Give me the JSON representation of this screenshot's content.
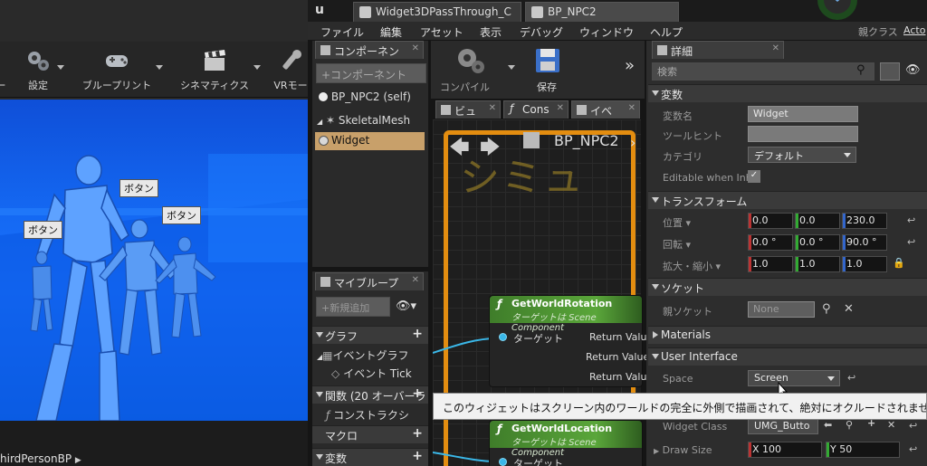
{
  "left_toolbar": {
    "items": [
      {
        "label": "ー",
        "icon": "partial-icon"
      },
      {
        "label": "設定",
        "icon": "gears-icon"
      },
      {
        "label": "ブループリント",
        "icon": "gamepad-icon"
      },
      {
        "label": "シネマティクス",
        "icon": "clapperboard-icon"
      },
      {
        "label": "VRモー",
        "icon": "wrench-icon"
      }
    ]
  },
  "viewport": {
    "labels": [
      "ボタン",
      "ボタン",
      "ボタン"
    ]
  },
  "outliner": {
    "item": "hirdPersonBP"
  },
  "tabs": [
    {
      "label": "Widget3DPassThrough_C",
      "icon": "folder-icon"
    },
    {
      "label": "BP_NPC2",
      "icon": "blueprint-icon"
    }
  ],
  "parent_class": {
    "label": "親クラス",
    "value": "Acto"
  },
  "menu": [
    "ファイル",
    "編集",
    "アセット",
    "表示",
    "デバッグ",
    "ウィンドウ",
    "ヘルプ"
  ],
  "components_panel": {
    "tab": "コンポーネン",
    "add_button": "+コンポーネント",
    "items": [
      "BP_NPC2 (self)",
      "SkeletalMesh",
      "Widget"
    ]
  },
  "my_blueprint": {
    "tab": "マイブループ",
    "new_button": "+新規追加",
    "sections": [
      {
        "label": "グラフ"
      },
      {
        "label": "イベントグラフ"
      },
      {
        "label": "イベント Tick"
      },
      {
        "label": "関数 (20 オーバーラ"
      },
      {
        "label": "コンストラクシ"
      },
      {
        "label": "マクロ"
      },
      {
        "label": "変数"
      }
    ]
  },
  "graph_toolbar": {
    "compile": "コンパイル",
    "save": "保存",
    "tabs": [
      "ビュ",
      "Cons",
      "イベ"
    ]
  },
  "graph": {
    "breadcrumb": "BP_NPC2",
    "watermark": "シミュ",
    "nodes": [
      {
        "title": "GetWorldRotation",
        "subtitle": "ターゲットは Scene Component",
        "target": "ターゲット",
        "outputs": [
          "Return Valu",
          "Return Value",
          "Return Valu"
        ]
      },
      {
        "title": "GetWorldLocation",
        "subtitle": "ターゲットは Scene Component",
        "target": "ターゲット"
      }
    ]
  },
  "details": {
    "tab": "詳細",
    "search_placeholder": "検索",
    "variables": {
      "header": "変数",
      "name_label": "変数名",
      "name_value": "Widget",
      "tooltip_label": "ツールヒント",
      "tooltip_value": "",
      "category_label": "カテゴリ",
      "category_value": "デフォルト",
      "editable_label": "Editable when Inhe"
    },
    "transform": {
      "header": "トランスフォーム",
      "location_label": "位置",
      "location": [
        "0.0",
        "0.0",
        "230.0"
      ],
      "rotation_label": "回転",
      "rotation": [
        "0.0 °",
        "0.0 °",
        "90.0 °"
      ],
      "scale_label": "拡大・縮小",
      "scale": [
        "1.0",
        "1.0",
        "1.0"
      ]
    },
    "socket": {
      "header": "ソケット",
      "parent_label": "親ソケット",
      "parent_value": "None"
    },
    "materials_header": "Materials",
    "ui": {
      "header": "User Interface",
      "space_label": "Space",
      "space_value": "Screen",
      "widget_class_label": "Widget Class",
      "widget_class_value": "UMG_Butto",
      "draw_size_label": "Draw Size",
      "draw_x": "X  100",
      "draw_y": "Y  50"
    }
  },
  "tooltip": "このウィジェットはスクリーン内のワールドの完全に外側で描画されて、絶対にオクルードされません"
}
